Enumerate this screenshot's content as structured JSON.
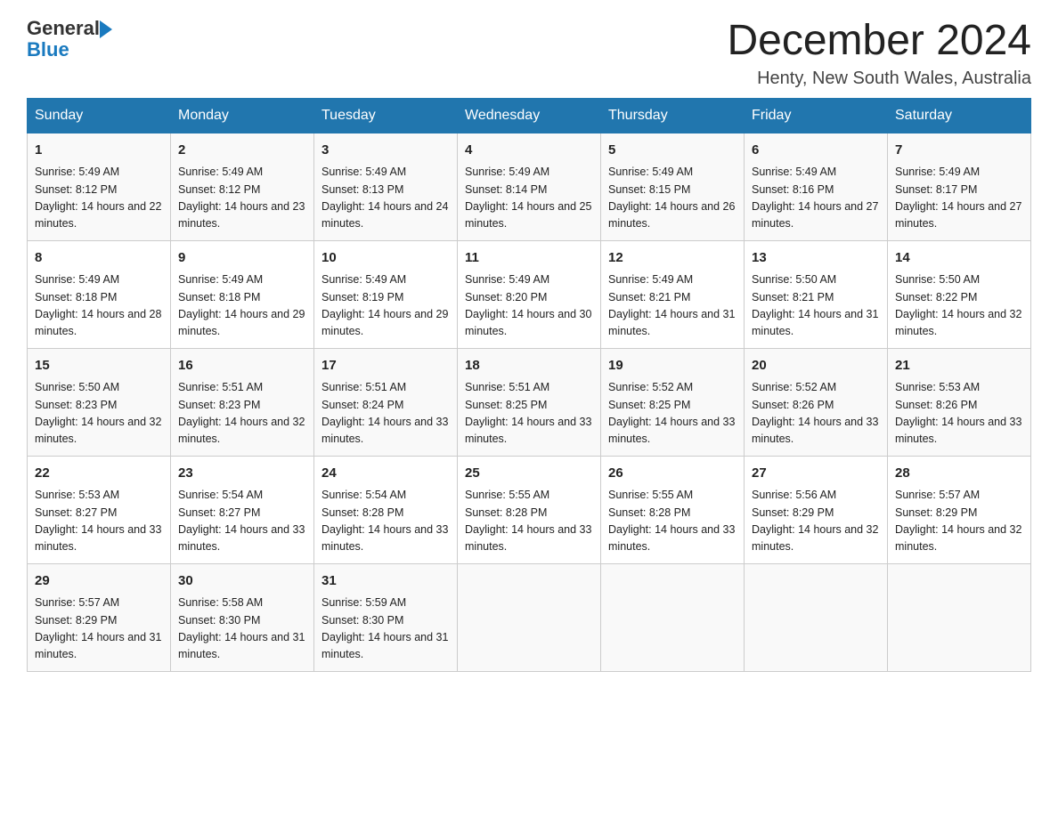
{
  "header": {
    "logo_text_general": "General",
    "logo_text_blue": "Blue",
    "month_title": "December 2024",
    "location": "Henty, New South Wales, Australia"
  },
  "days_of_week": [
    "Sunday",
    "Monday",
    "Tuesday",
    "Wednesday",
    "Thursday",
    "Friday",
    "Saturday"
  ],
  "weeks": [
    [
      {
        "day": "1",
        "sunrise": "5:49 AM",
        "sunset": "8:12 PM",
        "daylight": "14 hours and 22 minutes."
      },
      {
        "day": "2",
        "sunrise": "5:49 AM",
        "sunset": "8:12 PM",
        "daylight": "14 hours and 23 minutes."
      },
      {
        "day": "3",
        "sunrise": "5:49 AM",
        "sunset": "8:13 PM",
        "daylight": "14 hours and 24 minutes."
      },
      {
        "day": "4",
        "sunrise": "5:49 AM",
        "sunset": "8:14 PM",
        "daylight": "14 hours and 25 minutes."
      },
      {
        "day": "5",
        "sunrise": "5:49 AM",
        "sunset": "8:15 PM",
        "daylight": "14 hours and 26 minutes."
      },
      {
        "day": "6",
        "sunrise": "5:49 AM",
        "sunset": "8:16 PM",
        "daylight": "14 hours and 27 minutes."
      },
      {
        "day": "7",
        "sunrise": "5:49 AM",
        "sunset": "8:17 PM",
        "daylight": "14 hours and 27 minutes."
      }
    ],
    [
      {
        "day": "8",
        "sunrise": "5:49 AM",
        "sunset": "8:18 PM",
        "daylight": "14 hours and 28 minutes."
      },
      {
        "day": "9",
        "sunrise": "5:49 AM",
        "sunset": "8:18 PM",
        "daylight": "14 hours and 29 minutes."
      },
      {
        "day": "10",
        "sunrise": "5:49 AM",
        "sunset": "8:19 PM",
        "daylight": "14 hours and 29 minutes."
      },
      {
        "day": "11",
        "sunrise": "5:49 AM",
        "sunset": "8:20 PM",
        "daylight": "14 hours and 30 minutes."
      },
      {
        "day": "12",
        "sunrise": "5:49 AM",
        "sunset": "8:21 PM",
        "daylight": "14 hours and 31 minutes."
      },
      {
        "day": "13",
        "sunrise": "5:50 AM",
        "sunset": "8:21 PM",
        "daylight": "14 hours and 31 minutes."
      },
      {
        "day": "14",
        "sunrise": "5:50 AM",
        "sunset": "8:22 PM",
        "daylight": "14 hours and 32 minutes."
      }
    ],
    [
      {
        "day": "15",
        "sunrise": "5:50 AM",
        "sunset": "8:23 PM",
        "daylight": "14 hours and 32 minutes."
      },
      {
        "day": "16",
        "sunrise": "5:51 AM",
        "sunset": "8:23 PM",
        "daylight": "14 hours and 32 minutes."
      },
      {
        "day": "17",
        "sunrise": "5:51 AM",
        "sunset": "8:24 PM",
        "daylight": "14 hours and 33 minutes."
      },
      {
        "day": "18",
        "sunrise": "5:51 AM",
        "sunset": "8:25 PM",
        "daylight": "14 hours and 33 minutes."
      },
      {
        "day": "19",
        "sunrise": "5:52 AM",
        "sunset": "8:25 PM",
        "daylight": "14 hours and 33 minutes."
      },
      {
        "day": "20",
        "sunrise": "5:52 AM",
        "sunset": "8:26 PM",
        "daylight": "14 hours and 33 minutes."
      },
      {
        "day": "21",
        "sunrise": "5:53 AM",
        "sunset": "8:26 PM",
        "daylight": "14 hours and 33 minutes."
      }
    ],
    [
      {
        "day": "22",
        "sunrise": "5:53 AM",
        "sunset": "8:27 PM",
        "daylight": "14 hours and 33 minutes."
      },
      {
        "day": "23",
        "sunrise": "5:54 AM",
        "sunset": "8:27 PM",
        "daylight": "14 hours and 33 minutes."
      },
      {
        "day": "24",
        "sunrise": "5:54 AM",
        "sunset": "8:28 PM",
        "daylight": "14 hours and 33 minutes."
      },
      {
        "day": "25",
        "sunrise": "5:55 AM",
        "sunset": "8:28 PM",
        "daylight": "14 hours and 33 minutes."
      },
      {
        "day": "26",
        "sunrise": "5:55 AM",
        "sunset": "8:28 PM",
        "daylight": "14 hours and 33 minutes."
      },
      {
        "day": "27",
        "sunrise": "5:56 AM",
        "sunset": "8:29 PM",
        "daylight": "14 hours and 32 minutes."
      },
      {
        "day": "28",
        "sunrise": "5:57 AM",
        "sunset": "8:29 PM",
        "daylight": "14 hours and 32 minutes."
      }
    ],
    [
      {
        "day": "29",
        "sunrise": "5:57 AM",
        "sunset": "8:29 PM",
        "daylight": "14 hours and 31 minutes."
      },
      {
        "day": "30",
        "sunrise": "5:58 AM",
        "sunset": "8:30 PM",
        "daylight": "14 hours and 31 minutes."
      },
      {
        "day": "31",
        "sunrise": "5:59 AM",
        "sunset": "8:30 PM",
        "daylight": "14 hours and 31 minutes."
      },
      null,
      null,
      null,
      null
    ]
  ]
}
